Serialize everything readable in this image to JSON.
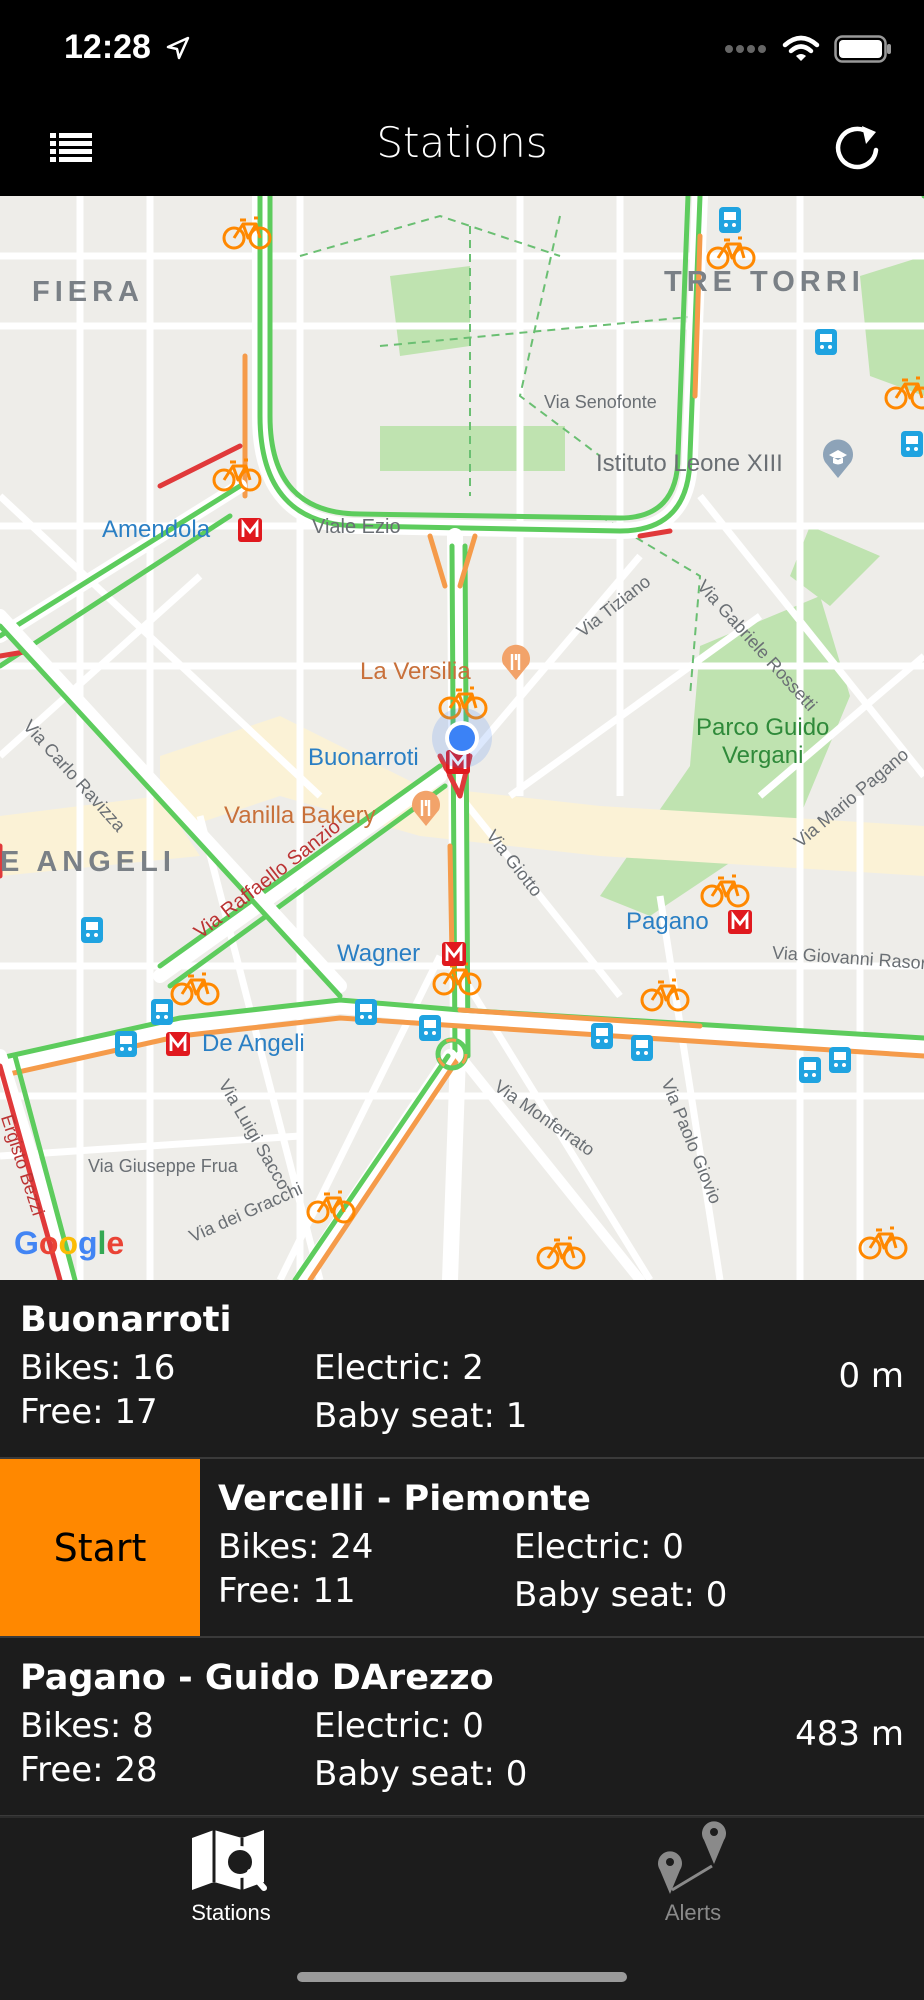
{
  "status_bar": {
    "time": "12:28"
  },
  "nav": {
    "title": "Stations"
  },
  "map": {
    "districts": [
      "FIERA",
      "TRE TORRI",
      "E ANGELI"
    ],
    "metro_stations": [
      "Amendola",
      "Buonarroti",
      "Wagner",
      "De Angeli",
      "Pagano"
    ],
    "pois": [
      "La Versilia",
      "Vanilla Bakery"
    ],
    "institution": "Istituto Leone XIII",
    "park": [
      "Parco Guido",
      "Vergani"
    ],
    "streets": [
      "Viale Ezio",
      "Via Senofonte",
      "Via Tiziano",
      "Via Gabriele Rossetti",
      "Via Carlo Ravizza",
      "Via Raffaello Sanzio",
      "Via Giotto",
      "Via Mario Pagano",
      "Via Giovanni Rasori",
      "Via Monferrato",
      "Via Paolo Giovio",
      "Via Luigi Sacco",
      "Via Giuseppe Frua",
      "Via dei Gracchi",
      "Ergisto Bezzi"
    ],
    "attribution": "Google"
  },
  "stations": [
    {
      "name": "Buonarroti",
      "bikes": "Bikes: 16",
      "free": "Free: 17",
      "electric": "Electric: 2",
      "baby_seat": "Baby seat: 1",
      "distance": "0 m"
    },
    {
      "name": "Vercelli - Piemonte",
      "bikes": "Bikes: 24",
      "free": "Free: 11",
      "electric": "Electric: 0",
      "baby_seat": "Baby seat: 0",
      "action": "Start"
    },
    {
      "name": "Pagano - Guido DArezzo",
      "bikes": "Bikes: 8",
      "free": "Free: 28",
      "electric": "Electric: 0",
      "baby_seat": "Baby seat: 0",
      "distance": "483 m"
    }
  ],
  "tabs": [
    {
      "label": "Stations",
      "active": true,
      "icon": "map-icon"
    },
    {
      "label": "Alerts",
      "active": false,
      "icon": "pins-icon"
    }
  ],
  "colors": {
    "accent": "#ff8800",
    "list_bg": "#1c1c1c",
    "route_green": "#5dcc5d",
    "route_orange": "#f59b4a",
    "route_red": "#e0393a",
    "metro_red": "#e0191e",
    "user_location": "#3b82f6"
  }
}
